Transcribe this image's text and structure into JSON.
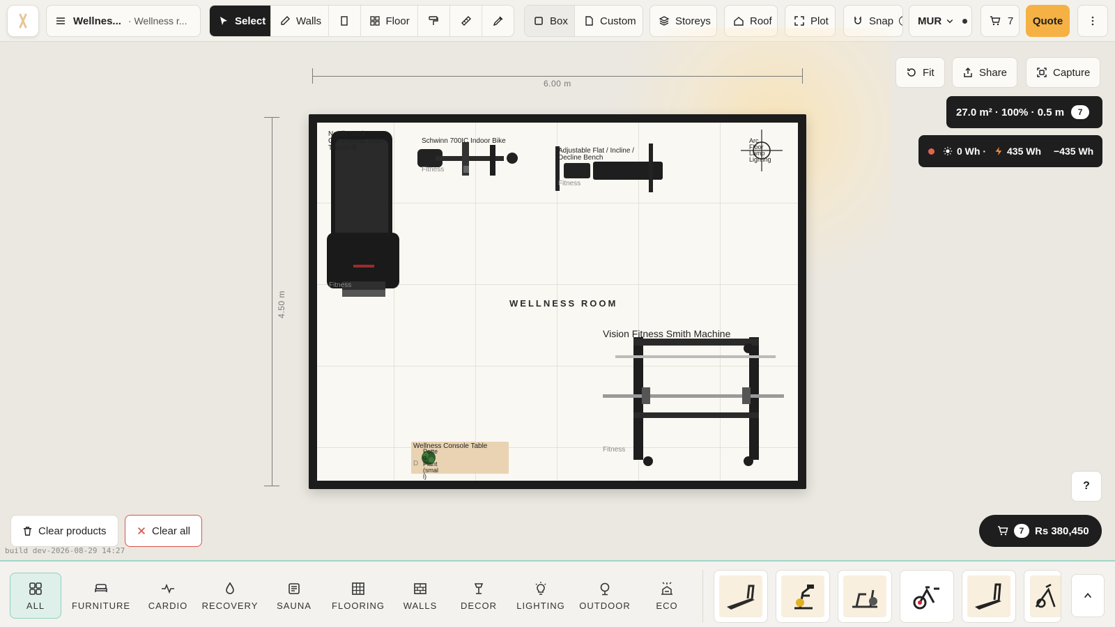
{
  "toolbar": {
    "project_name": "Wellnes...",
    "project_room": "· Wellness r...",
    "tools": {
      "select": "Select",
      "walls": "Walls",
      "floor": "Floor"
    },
    "shapes": {
      "box": "Box",
      "custom": "Custom"
    },
    "storeys": "Storeys",
    "roof": "Roof",
    "plot": "Plot",
    "snap": "Snap",
    "currency": "MUR",
    "cart_count": "7",
    "quote": "Quote"
  },
  "canvas": {
    "width_dim": "6.00 m",
    "height_dim": "4.50 m",
    "room_label": "WELLNESS ROOM",
    "products": {
      "treadmill_name": [
        "NordicTrack",
        "Commercial 2450",
        "Treadmill"
      ],
      "treadmill_cat": "Fitness",
      "bike_name": "Schwinn 700IC Indoor Bike",
      "bike_cat": "Fitness",
      "bench_name": [
        "Adjustable Flat / Incline /",
        "Decline Bench"
      ],
      "bench_cat": "Fitness",
      "lamp_name": [
        "Arc",
        "Floor",
        "Lamp",
        "Lighting"
      ],
      "smith_name": "Vision Fitness Smith Machine",
      "smith_cat": "Fitness",
      "console_name": "Wellness Console Table",
      "plant_name": [
        "Potte",
        "d",
        "Plant",
        "(smal",
        "l)"
      ],
      "plant_cat": "D"
    }
  },
  "view_controls": {
    "fit": "Fit",
    "share": "Share",
    "capture": "Capture"
  },
  "stats": {
    "summary": "27.0 m² · 100% · 0.5 m",
    "count": "7"
  },
  "energy": {
    "solar": "0 Wh ·",
    "consumption": "435 Wh",
    "net": "−435 Wh"
  },
  "help": "?",
  "cart": {
    "count": "7",
    "total": "Rs 380,450"
  },
  "actions": {
    "clear_products": "Clear products",
    "clear_all": "Clear all"
  },
  "build": "build dev-2026-08-29 14:27",
  "categories": [
    {
      "label": "ALL",
      "icon": "grid-icon"
    },
    {
      "label": "FURNITURE",
      "icon": "bed-icon"
    },
    {
      "label": "CARDIO",
      "icon": "pulse-icon"
    },
    {
      "label": "RECOVERY",
      "icon": "droplet-icon"
    },
    {
      "label": "SAUNA",
      "icon": "sauna-icon"
    },
    {
      "label": "FLOORING",
      "icon": "tiles-icon"
    },
    {
      "label": "WALLS",
      "icon": "wall-icon"
    },
    {
      "label": "DECOR",
      "icon": "lamp-icon"
    },
    {
      "label": "LIGHTING",
      "icon": "bulb-icon"
    },
    {
      "label": "OUTDOOR",
      "icon": "tree-icon"
    },
    {
      "label": "ECO",
      "icon": "eco-icon"
    }
  ],
  "colors": {
    "accent": "#f5b144",
    "dark": "#1e1e1e",
    "active_category": "#dff0ea",
    "danger": "#d9534f"
  }
}
